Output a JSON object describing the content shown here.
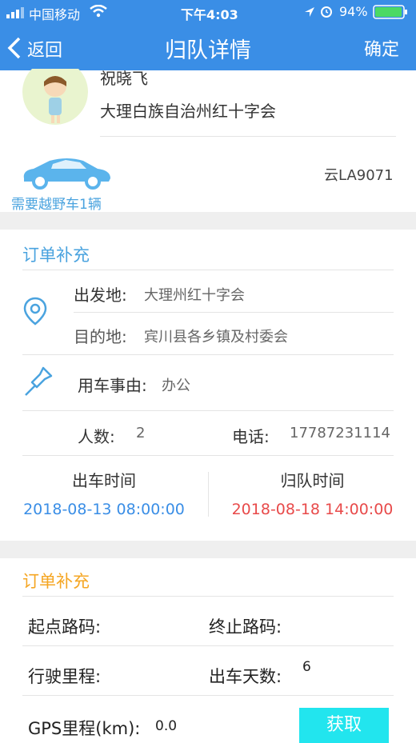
{
  "status_bar": {
    "carrier": "中国移动",
    "time": "下午4:03",
    "battery": "94%"
  },
  "nav": {
    "back_label": "返回",
    "title": "归队详情",
    "confirm_label": "确定"
  },
  "profile": {
    "name": "祝晓飞",
    "organization": "大理白族自治州红十字会"
  },
  "vehicle": {
    "need_text": "需要越野车1辆",
    "plate": "云LA9071"
  },
  "order1": {
    "section_title": "订单补充",
    "departure_label": "出发地:",
    "departure_value": "大理州红十字会",
    "destination_label": "目的地:",
    "destination_value": "宾川县各乡镇及村委会",
    "reason_label": "用车事由:",
    "reason_value": "办公",
    "people_label": "人数:",
    "people_value": "2",
    "phone_label": "电话:",
    "phone_value": "17787231114",
    "depart_time_label": "出车时间",
    "depart_time_value": "2018-08-13 08:00:00",
    "return_time_label": "归队时间",
    "return_time_value": "2018-08-18 14:00:00"
  },
  "order2": {
    "section_title": "订单补充",
    "start_code_label": "起点路码:",
    "end_code_label": "终止路码:",
    "mileage_label": "行驶里程:",
    "days_label": "出车天数:",
    "days_value": "6",
    "gps_label": "GPS里程(km):",
    "gps_value": "0.0",
    "fetch_button": "获取"
  },
  "colors": {
    "primary": "#3a8ee6",
    "section_blue": "#4aa3df",
    "section_orange": "#f5a623",
    "return_red": "#e84a4a",
    "fetch_cyan": "#22e5ee"
  }
}
